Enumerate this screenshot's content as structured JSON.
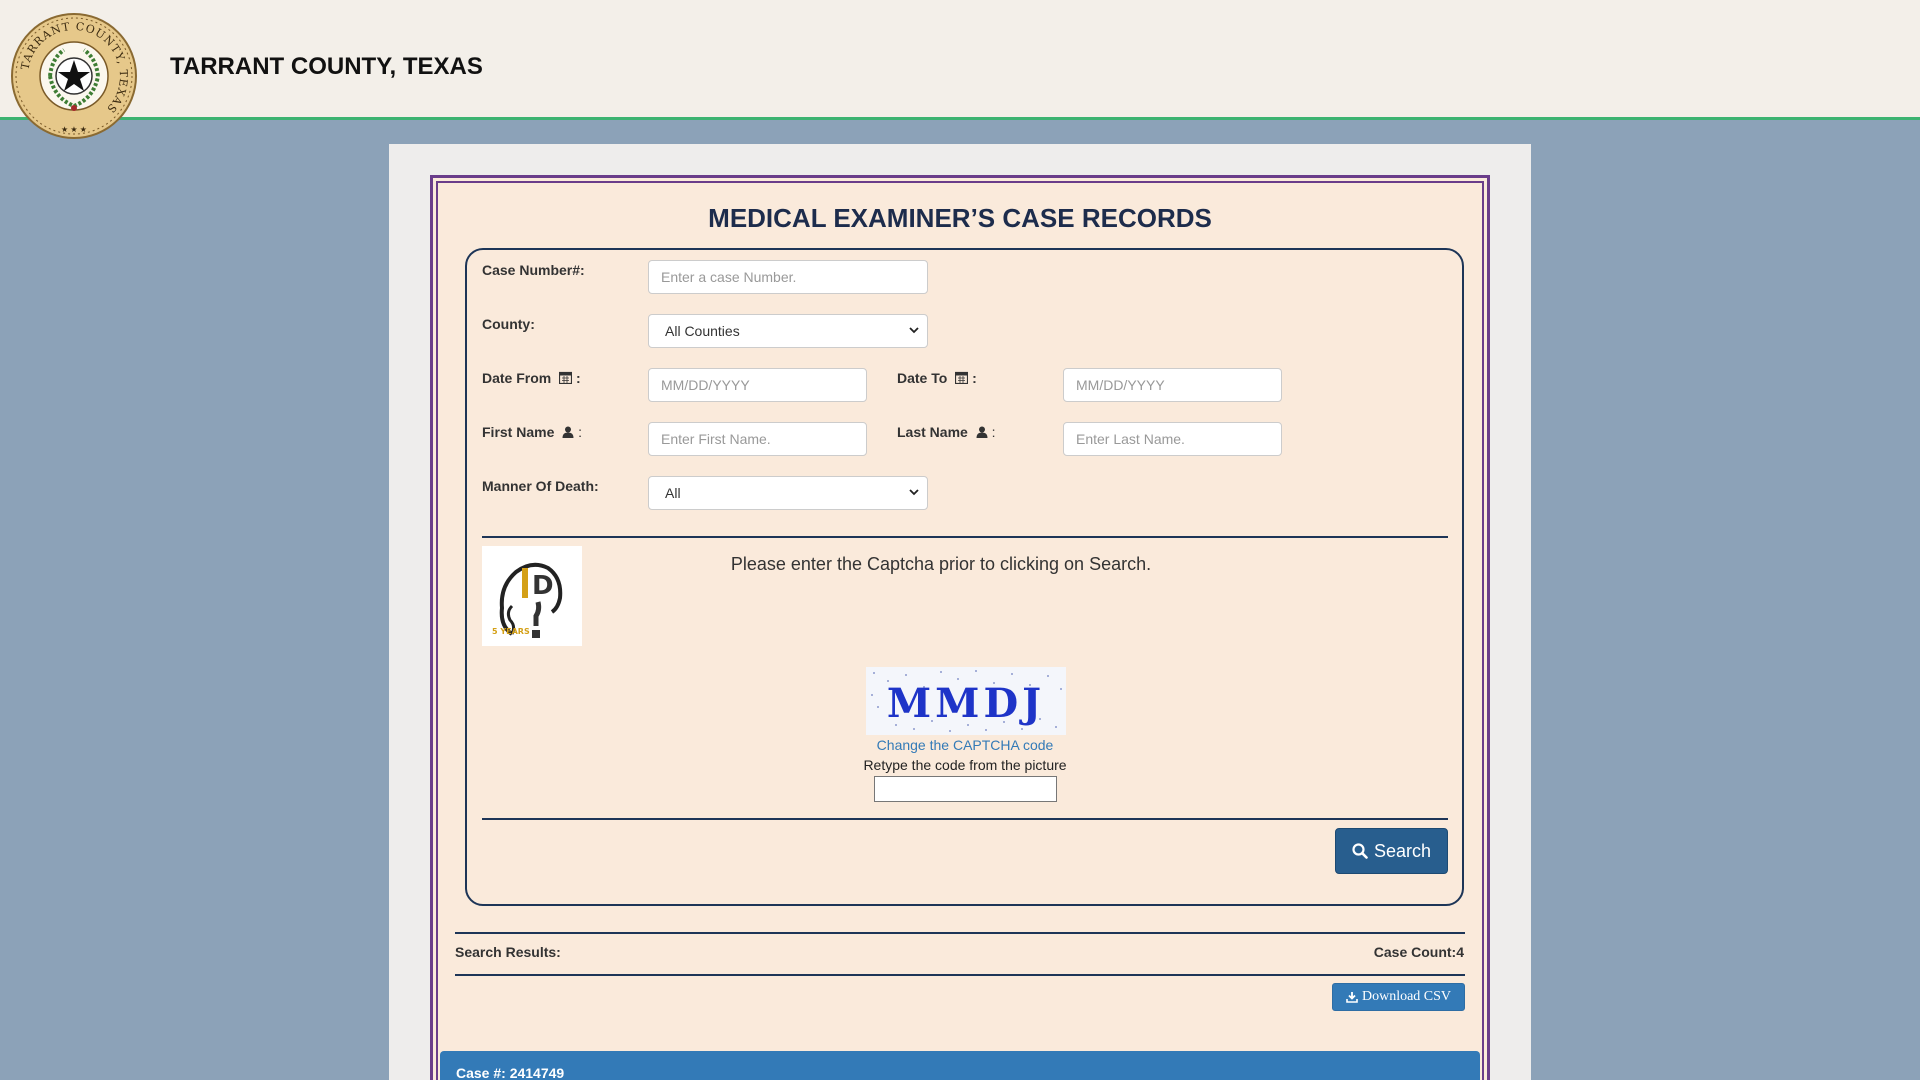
{
  "header": {
    "title": "TARRANT COUNTY, TEXAS",
    "seal_icon": "county-seal-icon",
    "seal_text": "TARRANT COUNTY, TEXAS"
  },
  "page": {
    "title": "MEDICAL EXAMINER’S CASE RECORDS"
  },
  "form": {
    "case_number": {
      "label": "Case Number#:",
      "placeholder": "Enter a case Number."
    },
    "county": {
      "label": "County:",
      "value": "All Counties"
    },
    "date_from": {
      "label": "Date From",
      "suffix": ":",
      "placeholder": "MM/DD/YYYY",
      "icon": "calendar-icon"
    },
    "date_to": {
      "label": "Date To",
      "suffix": ":",
      "placeholder": "MM/DD/YYYY",
      "icon": "calendar-icon"
    },
    "first_name": {
      "label": "First Name",
      "suffix": ":",
      "placeholder": "Enter First Name.",
      "icon": "user-icon"
    },
    "last_name": {
      "label": "Last Name",
      "suffix": ":",
      "placeholder": "Enter Last Name.",
      "icon": "user-icon"
    },
    "manner_of_death": {
      "label": "Manner Of Death:",
      "value": "All"
    }
  },
  "captcha": {
    "message": "Please enter the Captcha prior to clicking on Search.",
    "code": "MMDJ",
    "change_link": "Change the CAPTCHA code",
    "hint": "Retype the code from the picture",
    "logo_text": "5 YEARS",
    "logo_icon": "namus-id-logo-icon"
  },
  "actions": {
    "search_label": "Search",
    "search_icon": "search-icon",
    "download_label": "Download CSV",
    "download_icon": "download-icon"
  },
  "results": {
    "label": "Search Results:",
    "count_label": "Case Count:4",
    "first_case": "Case #: 2414749"
  },
  "colors": {
    "page_bg": "#8ca2b8",
    "header_bg": "#f3efe9",
    "header_rule": "#3cb371",
    "frame_border": "#6a3d8a",
    "form_bg": "#faeadb",
    "title_color": "#1d2c4c",
    "primary_button": "#285e8e",
    "link": "#337ab7"
  }
}
